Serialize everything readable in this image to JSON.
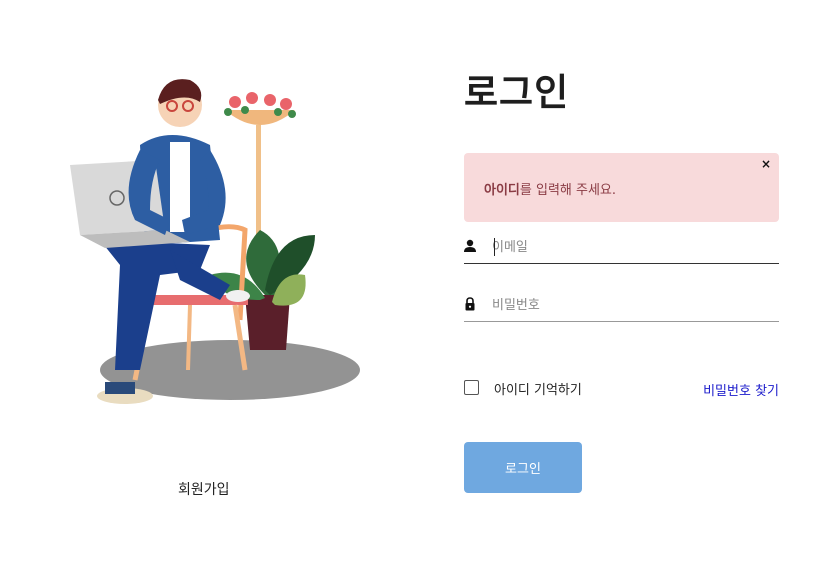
{
  "signup": {
    "label": "회원가입"
  },
  "login": {
    "title": "로그인",
    "alert": {
      "emphasis": "아이디",
      "message": "를 입력해 주세요.",
      "close": "×"
    },
    "email": {
      "placeholder": "이메일",
      "icon": "person-icon"
    },
    "password": {
      "placeholder": "비밀번호",
      "icon": "lock-icon"
    },
    "remember_label": "아이디 기억하기",
    "find_password": "비밀번호 찾기",
    "submit_label": "로그인",
    "button_color": "#6fa8e0",
    "alert_color": "#f8dadb",
    "link_color": "#1a1acb"
  }
}
